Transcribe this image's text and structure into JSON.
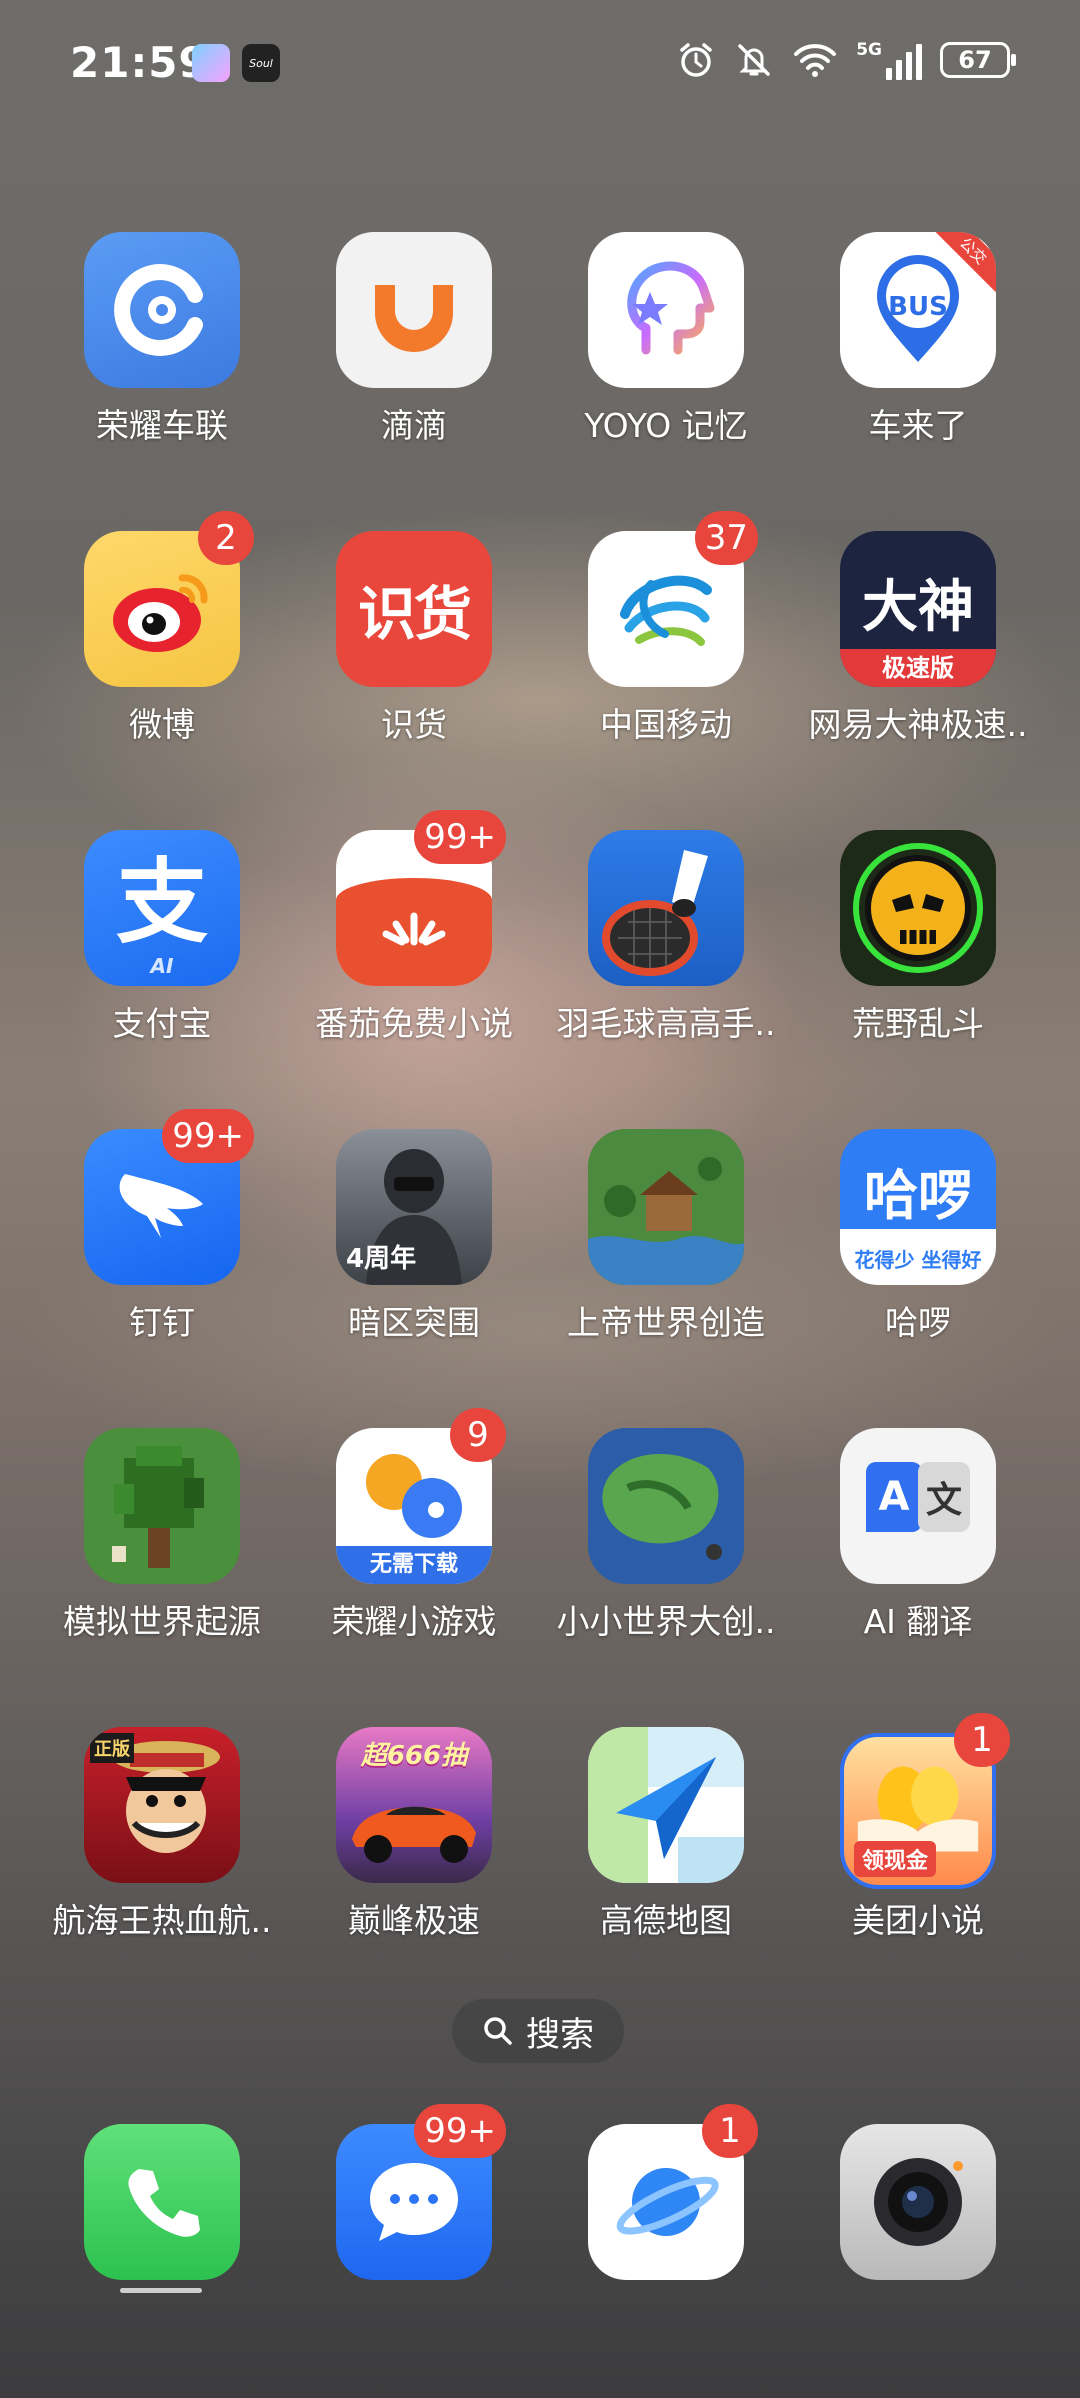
{
  "status_bar": {
    "time": "21:59",
    "battery": "67",
    "network": "5G",
    "notif_icons": [
      "game-center-icon",
      "soul-app-icon"
    ]
  },
  "apps": [
    {
      "label": "荣耀车联",
      "icon": "honor-car-link-icon",
      "badge": ""
    },
    {
      "label": "滴滴",
      "icon": "didi-icon",
      "badge": ""
    },
    {
      "label": "YOYO 记忆",
      "icon": "yoyo-memory-icon",
      "badge": ""
    },
    {
      "label": "车来了",
      "icon": "chelaile-bus-icon",
      "badge": "",
      "icon_text": "BUS",
      "corner_tag": "公交"
    },
    {
      "label": "微博",
      "icon": "weibo-icon",
      "badge": "2"
    },
    {
      "label": "识货",
      "icon": "shihuo-icon",
      "badge": "",
      "icon_text": "识货"
    },
    {
      "label": "中国移动",
      "icon": "china-mobile-icon",
      "badge": "37"
    },
    {
      "label": "网易大神极速..",
      "icon": "netease-dashen-icon",
      "badge": "",
      "icon_text": "大神",
      "icon_subtext": "极速版"
    },
    {
      "label": "支付宝",
      "icon": "alipay-icon",
      "badge": "",
      "icon_text": "支",
      "icon_subtext": "AI"
    },
    {
      "label": "番茄免费小说",
      "icon": "tomato-novel-icon",
      "badge": "99+"
    },
    {
      "label": "羽毛球高高手..",
      "icon": "badminton-game-icon",
      "badge": ""
    },
    {
      "label": "荒野乱斗",
      "icon": "brawl-stars-icon",
      "badge": ""
    },
    {
      "label": "钉钉",
      "icon": "dingtalk-icon",
      "badge": "99+"
    },
    {
      "label": "暗区突围",
      "icon": "arena-breakout-icon",
      "badge": "",
      "icon_text": "4周年"
    },
    {
      "label": "上帝世界创造",
      "icon": "god-world-creator-icon",
      "badge": ""
    },
    {
      "label": "哈啰",
      "icon": "hello-bike-icon",
      "badge": "",
      "icon_text": "哈啰",
      "icon_subtext": "花得少 坐得好"
    },
    {
      "label": "模拟世界起源",
      "icon": "simulated-world-icon",
      "badge": ""
    },
    {
      "label": "荣耀小游戏",
      "icon": "honor-mini-games-icon",
      "badge": "9",
      "icon_subtext": "无需下载"
    },
    {
      "label": "小小世界大创..",
      "icon": "tiny-world-icon",
      "badge": ""
    },
    {
      "label": "AI 翻译",
      "icon": "ai-translate-icon",
      "badge": "",
      "icon_text": "A",
      "icon_text2": "文"
    },
    {
      "label": "航海王热血航..",
      "icon": "one-piece-icon",
      "badge": "",
      "icon_text": "正版"
    },
    {
      "label": "巅峰极速",
      "icon": "racing-master-icon",
      "badge": "",
      "icon_text": "超666抽"
    },
    {
      "label": "高德地图",
      "icon": "amap-icon",
      "badge": ""
    },
    {
      "label": "美团小说",
      "icon": "meituan-novel-icon",
      "badge": "1",
      "icon_text": "领现金"
    }
  ],
  "search": {
    "label": "搜索"
  },
  "dock": [
    {
      "name": "phone",
      "icon": "phone-icon",
      "badge": ""
    },
    {
      "name": "messages",
      "icon": "messages-icon",
      "badge": "99+"
    },
    {
      "name": "browser",
      "icon": "browser-planet-icon",
      "badge": "1"
    },
    {
      "name": "camera",
      "icon": "camera-icon",
      "badge": ""
    }
  ],
  "colors": {
    "badge": "#e8453c",
    "label": "#ffffff"
  }
}
